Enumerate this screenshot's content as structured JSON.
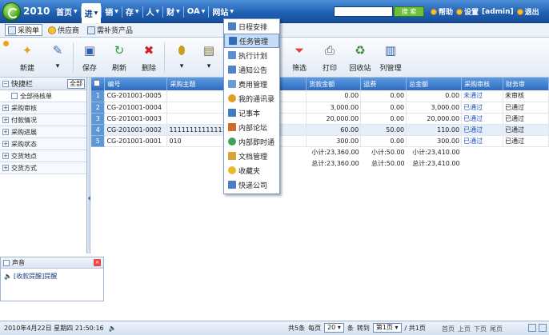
{
  "logo": {
    "year": "2010"
  },
  "nav": {
    "items": [
      {
        "label": "首页",
        "arrow": "▼"
      },
      {
        "label": "进",
        "arrow": "▼"
      },
      {
        "label": "销",
        "arrow": "▼"
      },
      {
        "label": "存",
        "arrow": "▼"
      },
      {
        "label": "人",
        "arrow": "▼"
      },
      {
        "label": "财",
        "arrow": "▼"
      },
      {
        "label": "OA",
        "arrow": "▼"
      },
      {
        "label": "网站",
        "arrow": "▼"
      }
    ],
    "search_button": "搜 索",
    "help": "帮助",
    "settings": "设置",
    "user": "[admin]",
    "logout": "退出"
  },
  "subtabs": [
    "采购单",
    "供应商",
    "需补货产品"
  ],
  "toolbar": {
    "new": "新建",
    "save": "保存",
    "refresh": "刷新",
    "delete": "删除",
    "filter": "筛选",
    "print": "打印",
    "recycle": "回收站",
    "columns": "列管理"
  },
  "left_panel": {
    "title": "快捷栏",
    "all": "全部",
    "items": [
      {
        "label": "全部待核单",
        "sub": true
      },
      {
        "label": "采购审核",
        "sub": false
      },
      {
        "label": "付款情况",
        "sub": false
      },
      {
        "label": "采购进展",
        "sub": false
      },
      {
        "label": "采购状态",
        "sub": false
      },
      {
        "label": "交货地点",
        "sub": false
      },
      {
        "label": "交货方式",
        "sub": false
      }
    ]
  },
  "sound_panel": {
    "title": "声音",
    "message": "[收款提醒]提醒"
  },
  "table": {
    "headers": [
      "编号",
      "采购主题",
      "",
      "应商",
      "货款金额",
      "运费",
      "总金额",
      "采购审核",
      "财务审"
    ],
    "rows": [
      {
        "rn": "1",
        "code": "CG-201001-0005",
        "subject": "",
        "c3": "2",
        "supplier": "",
        "goods": "0.00",
        "freight": "0.00",
        "total": "0.00",
        "audit": "未通过",
        "finance": "未审核"
      },
      {
        "rn": "2",
        "code": "CG-201001-0004",
        "subject": "",
        "c3": "2",
        "supplier": "",
        "goods": "3,000.00",
        "freight": "0.00",
        "total": "3,000.00",
        "audit": "已通过",
        "finance": "已通过"
      },
      {
        "rn": "3",
        "code": "CG-201001-0003",
        "subject": "",
        "c3": "2",
        "supplier": "",
        "goods": "20,000.00",
        "freight": "0.00",
        "total": "20,000.00",
        "audit": "已通过",
        "finance": "已通过"
      },
      {
        "rn": "4",
        "code": "CG-201001-0002",
        "subject": "11111111111111",
        "c3": "2",
        "supplier": "3",
        "goods": "60.00",
        "freight": "50.00",
        "total": "110.00",
        "audit": "已通过",
        "finance": "已通过"
      },
      {
        "rn": "5",
        "code": "CG-201001-0001",
        "subject": "010",
        "c3": "2",
        "supplier": "",
        "goods": "300.00",
        "freight": "0.00",
        "total": "300.00",
        "audit": "已通过",
        "finance": "已通过"
      }
    ],
    "subtotal": {
      "goods": "小计:23,360.00",
      "freight": "小计:50.00",
      "total": "小计:23,410.00"
    },
    "grand_total": {
      "goods": "总计:23,360.00",
      "freight": "总计:50.00",
      "total": "总计:23,410.00"
    }
  },
  "oa_menu": {
    "items": [
      {
        "label": "日程安排",
        "color": "#4a7fc4"
      },
      {
        "label": "任务管理",
        "color": "#2f6fb9"
      },
      {
        "label": "执行计划",
        "color": "#5a8fcf"
      },
      {
        "label": "通知公告",
        "color": "#4f84c9"
      },
      {
        "label": "费用管理",
        "color": "#6b9ad6"
      },
      {
        "label": "我的通讯录",
        "color": "#e1a020"
      },
      {
        "label": "记事本",
        "color": "#3d7bc6"
      },
      {
        "label": "内部论坛",
        "color": "#d06a2a"
      },
      {
        "label": "内部即时通",
        "color": "#3aa55a"
      },
      {
        "label": "文档管理",
        "color": "#d9a23a"
      },
      {
        "label": "收藏夹",
        "color": "#e7b92e"
      },
      {
        "label": "快递公司",
        "color": "#4a7fc4"
      }
    ],
    "highlighted_index": 1
  },
  "statusbar": {
    "datetime": "2010年4月22日 星期四 21:50:16",
    "total_records": "共5条",
    "per_page_label": "每页",
    "per_page": "20",
    "unit": "条",
    "goto": "转到",
    "page_select": "第1页",
    "page_count": "/ 共1页",
    "first": "首页",
    "prev": "上页",
    "next": "下页",
    "last": "尾页"
  }
}
